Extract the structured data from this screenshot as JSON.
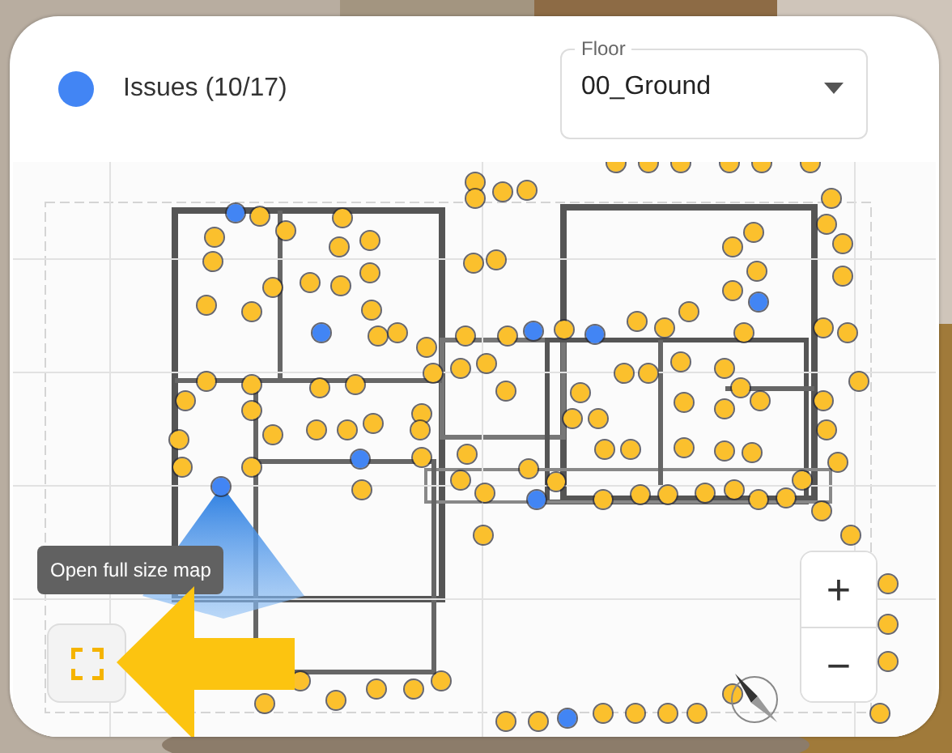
{
  "legend": {
    "label": "Issues (10/17)"
  },
  "floor_select": {
    "label": "Floor",
    "value": "00_Ground"
  },
  "tooltip": "Open full size map",
  "zoom_buttons": [
    "+",
    "−"
  ],
  "markers": [
    {
      "color": "#4285f4"
    },
    {
      "color": "#4285f4"
    },
    {
      "color": "#4285f4"
    },
    {
      "color": "#4285f4"
    },
    {
      "color": "#4285f4"
    },
    {
      "color": "#4285f4"
    },
    {
      "color": "#4285f4"
    },
    {
      "color": "#4285f4"
    },
    {
      "color": "#4285f4"
    },
    {
      "color": "#fbc02d"
    },
    {
      "color": "#fbc02d"
    },
    {
      "color": "#fbc02d"
    },
    {
      "color": "#fbc02d"
    },
    {
      "color": "#fbc02d"
    },
    {
      "color": "#fbc02d"
    },
    {
      "color": "#fbc02d"
    },
    {
      "color": "#fbc02d"
    },
    {
      "color": "#fbc02d"
    },
    {
      "color": "#fbc02d"
    },
    {
      "color": "#fbc02d"
    },
    {
      "color": "#fbc02d"
    },
    {
      "color": "#fbc02d"
    },
    {
      "color": "#fbc02d"
    },
    {
      "color": "#fbc02d"
    },
    {
      "color": "#fbc02d"
    },
    {
      "color": "#fbc02d"
    },
    {
      "color": "#fbc02d"
    },
    {
      "color": "#fbc02d"
    },
    {
      "color": "#fbc02d"
    },
    {
      "color": "#fbc02d"
    },
    {
      "color": "#fbc02d"
    },
    {
      "color": "#fbc02d"
    },
    {
      "color": "#fbc02d"
    },
    {
      "color": "#fbc02d"
    },
    {
      "color": "#fbc02d"
    },
    {
      "color": "#fbc02d"
    },
    {
      "color": "#fbc02d"
    },
    {
      "color": "#fbc02d"
    },
    {
      "color": "#fbc02d"
    },
    {
      "color": "#fbc02d"
    },
    {
      "color": "#fbc02d"
    },
    {
      "color": "#fbc02d"
    },
    {
      "color": "#fbc02d"
    },
    {
      "color": "#fbc02d"
    },
    {
      "color": "#fbc02d"
    },
    {
      "color": "#fbc02d"
    },
    {
      "color": "#fbc02d"
    },
    {
      "color": "#fbc02d"
    },
    {
      "color": "#fbc02d"
    },
    {
      "color": "#fbc02d"
    },
    {
      "color": "#fbc02d"
    },
    {
      "color": "#fbc02d"
    },
    {
      "color": "#fbc02d"
    },
    {
      "color": "#fbc02d"
    },
    {
      "color": "#fbc02d"
    },
    {
      "color": "#fbc02d"
    },
    {
      "color": "#fbc02d"
    },
    {
      "color": "#fbc02d"
    },
    {
      "color": "#fbc02d"
    },
    {
      "color": "#fbc02d"
    },
    {
      "color": "#fbc02d"
    },
    {
      "color": "#fbc02d"
    },
    {
      "color": "#fbc02d"
    },
    {
      "color": "#fbc02d"
    },
    {
      "color": "#fbc02d"
    },
    {
      "color": "#fbc02d"
    },
    {
      "color": "#fbc02d"
    },
    {
      "color": "#fbc02d"
    },
    {
      "color": "#fbc02d"
    },
    {
      "color": "#fbc02d"
    },
    {
      "color": "#fbc02d"
    },
    {
      "color": "#fbc02d"
    },
    {
      "color": "#fbc02d"
    },
    {
      "color": "#fbc02d"
    },
    {
      "color": "#fbc02d"
    },
    {
      "color": "#fbc02d"
    },
    {
      "color": "#fbc02d"
    },
    {
      "color": "#fbc02d"
    },
    {
      "color": "#fbc02d"
    },
    {
      "color": "#fbc02d"
    },
    {
      "color": "#fbc02d"
    },
    {
      "color": "#fbc02d"
    },
    {
      "color": "#fbc02d"
    },
    {
      "color": "#fbc02d"
    },
    {
      "color": "#fbc02d"
    },
    {
      "color": "#fbc02d"
    },
    {
      "color": "#fbc02d"
    },
    {
      "color": "#fbc02d"
    },
    {
      "color": "#fbc02d"
    },
    {
      "color": "#fbc02d"
    },
    {
      "color": "#fbc02d"
    },
    {
      "color": "#fbc02d"
    },
    {
      "color": "#fbc02d"
    },
    {
      "color": "#fbc02d"
    },
    {
      "color": "#fbc02d"
    },
    {
      "color": "#fbc02d"
    },
    {
      "color": "#fbc02d"
    },
    {
      "color": "#fbc02d"
    },
    {
      "color": "#fbc02d"
    },
    {
      "color": "#fbc02d"
    },
    {
      "color": "#fbc02d"
    },
    {
      "color": "#fbc02d"
    },
    {
      "color": "#fbc02d"
    },
    {
      "color": "#fbc02d"
    },
    {
      "color": "#fbc02d"
    },
    {
      "color": "#fbc02d"
    },
    {
      "color": "#fbc02d"
    },
    {
      "color": "#fbc02d"
    },
    {
      "color": "#fbc02d"
    },
    {
      "color": "#fbc02d"
    },
    {
      "color": "#fbc02d"
    },
    {
      "color": "#fbc02d"
    },
    {
      "color": "#fbc02d"
    },
    {
      "color": "#fbc02d"
    },
    {
      "color": "#fbc02d"
    },
    {
      "color": "#fbc02d"
    },
    {
      "color": "#fbc02d"
    },
    {
      "color": "#fbc02d"
    },
    {
      "color": "#fbc02d"
    },
    {
      "color": "#fbc02d"
    },
    {
      "color": "#fbc02d"
    },
    {
      "color": "#fbc02d"
    },
    {
      "color": "#fbc02d"
    },
    {
      "color": "#fbc02d"
    },
    {
      "color": "#fbc02d"
    },
    {
      "color": "#fbc02d"
    },
    {
      "color": "#fbc02d"
    },
    {
      "color": "#fbc02d"
    },
    {
      "color": "#fbc02d"
    }
  ]
}
